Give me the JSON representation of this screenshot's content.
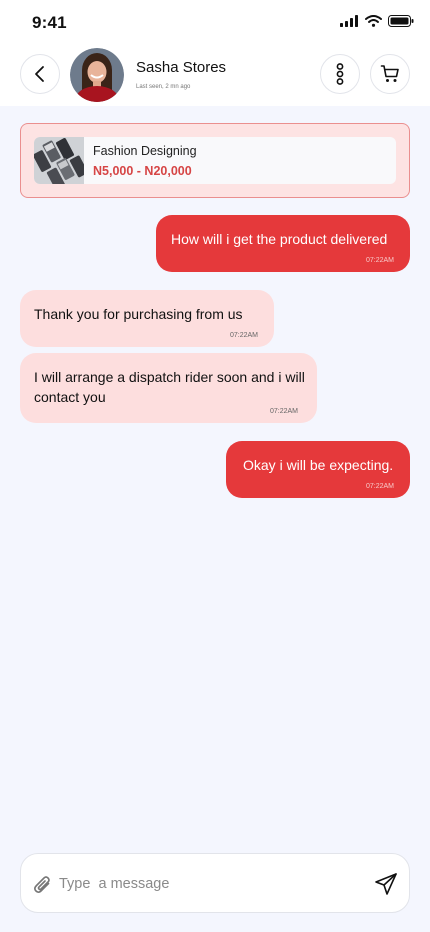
{
  "status_bar": {
    "time": "9:41"
  },
  "header": {
    "store_name": "Sasha Stores",
    "last_seen": "Last seen, 2 mn ago"
  },
  "product": {
    "title": "Fashion Designing",
    "price": "N5,000 - N20,000"
  },
  "messages": [
    {
      "direction": "outgoing",
      "text": "How will i get the product delivered",
      "time": "07:22AM"
    },
    {
      "direction": "incoming",
      "text": "Thank you for purchasing from us",
      "time": "07:22AM"
    },
    {
      "direction": "incoming",
      "text": "I will arrange a dispatch rider soon and i will contact you",
      "time": "07:22AM"
    },
    {
      "direction": "outgoing",
      "text": "Okay i will be expecting.",
      "time": "07:22AM"
    }
  ],
  "composer": {
    "placeholder": "Type  a message"
  },
  "colors": {
    "accent": "#e5393b",
    "incoming_bubble": "#fddede",
    "background": "#f4f6fe",
    "price": "#d64545"
  },
  "icons": {
    "back": "chevron-left-icon",
    "menu": "more-vertical-icon",
    "cart": "cart-icon",
    "attach": "paperclip-icon",
    "send": "send-icon"
  }
}
